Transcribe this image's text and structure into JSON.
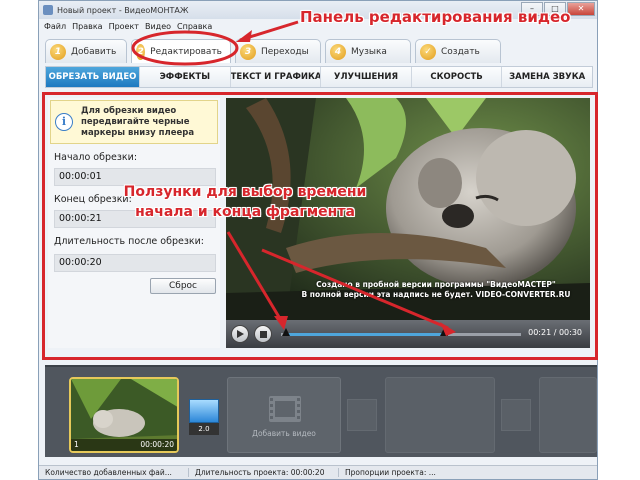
{
  "window": {
    "title": "Новый проект - ВидеоМОНТАЖ",
    "minimize": "–",
    "maximize": "□",
    "close": "✕"
  },
  "menu": [
    "Файл",
    "Правка",
    "Проект",
    "Видео",
    "Справка"
  ],
  "steps": [
    {
      "num": "1",
      "label": "Добавить"
    },
    {
      "num": "2",
      "label": "Редактировать"
    },
    {
      "num": "3",
      "label": "Переходы"
    },
    {
      "num": "4",
      "label": "Музыка"
    },
    {
      "num": "✓",
      "label": "Создать"
    }
  ],
  "tabs": [
    "ОБРЕЗАТЬ ВИДЕО",
    "ЭФФЕКТЫ",
    "ТЕКСТ И ГРАФИКА",
    "УЛУЧШЕНИЯ",
    "СКОРОСТЬ",
    "ЗАМЕНА ЗВУКА"
  ],
  "trim": {
    "info": "Для обрезки видео передвигайте черные маркеры внизу плеера",
    "start_label": "Начало обрезки:",
    "start_value": "00:00:01",
    "end_label": "Конец обрезки:",
    "end_value": "00:00:21",
    "duration_label": "Длительность после обрезки:",
    "duration_value": "00:00:20",
    "reset": "Сброс"
  },
  "player": {
    "watermark_line1": "Создано в пробной версии программы \"ВидеоМАСТЕР\"",
    "watermark_line2": "В полной версии эта надпись не будет. VIDEO-CONVERTER.RU",
    "time": "00:21 / 00:30",
    "progress": 0.68,
    "start_marker": 0.02,
    "end_marker": 0.68
  },
  "annotations": {
    "panel": "Панель редактирования видео",
    "sliders": "Ползунки для выбор времени начала и конца фрагмента"
  },
  "timeline": {
    "clip_index": "1",
    "clip_duration": "00:00:20",
    "transition": "2.0",
    "add_video": "Добавить видео"
  },
  "status": {
    "count": "Количество добавленных фай...",
    "duration": "Длительность проекта: 00:00:20",
    "proportions": "Пропорции проекта: ..."
  },
  "colors": {
    "accent": "#1d79c0",
    "highlight": "#d7262c",
    "step_badge": "#e29d1c"
  }
}
